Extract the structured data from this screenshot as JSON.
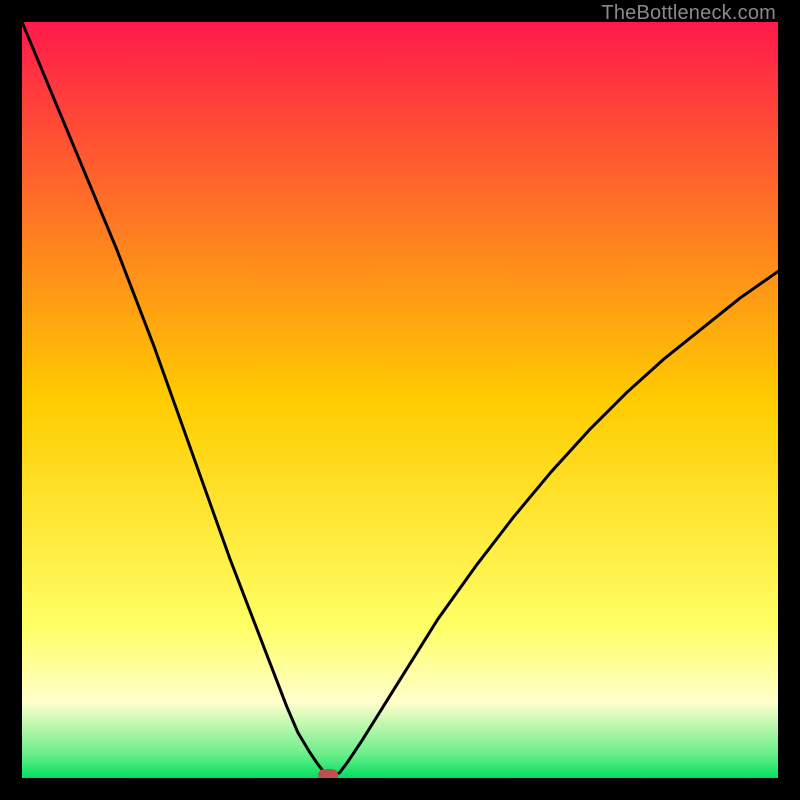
{
  "watermark": "TheBottleneck.com",
  "chart_data": {
    "type": "line",
    "title": "",
    "xlabel": "",
    "ylabel": "",
    "xlim": [
      0,
      100
    ],
    "ylim": [
      0,
      100
    ],
    "grid": false,
    "legend": false,
    "background_gradient": {
      "stops": [
        {
          "pos": 0.0,
          "color": "#ff1a4b"
        },
        {
          "pos": 0.5,
          "color": "#ffcc00"
        },
        {
          "pos": 0.8,
          "color": "#ffff66"
        },
        {
          "pos": 0.9,
          "color": "#ffffcc"
        },
        {
          "pos": 0.97,
          "color": "#66ee88"
        },
        {
          "pos": 1.0,
          "color": "#00e060"
        }
      ]
    },
    "series": [
      {
        "name": "curve",
        "x": [
          0,
          2.5,
          5,
          7.5,
          10,
          12.5,
          15,
          17.5,
          20,
          22.5,
          25,
          27.5,
          30,
          32.5,
          35,
          36.5,
          38,
          39,
          40,
          41,
          42,
          43,
          45,
          50,
          55,
          60,
          65,
          70,
          75,
          80,
          85,
          90,
          95,
          100
        ],
        "y": [
          100,
          94,
          88,
          82,
          76,
          70,
          63.5,
          57,
          50,
          43,
          36,
          29,
          22.5,
          16,
          9.5,
          6,
          3.5,
          2,
          0.7,
          0.3,
          0.7,
          2,
          5,
          13,
          21,
          28,
          34.5,
          40.5,
          46,
          51,
          55.5,
          59.5,
          63.5,
          67
        ]
      }
    ],
    "marker": {
      "x": 40.5,
      "y": 0.4,
      "color": "#c0504d"
    }
  }
}
